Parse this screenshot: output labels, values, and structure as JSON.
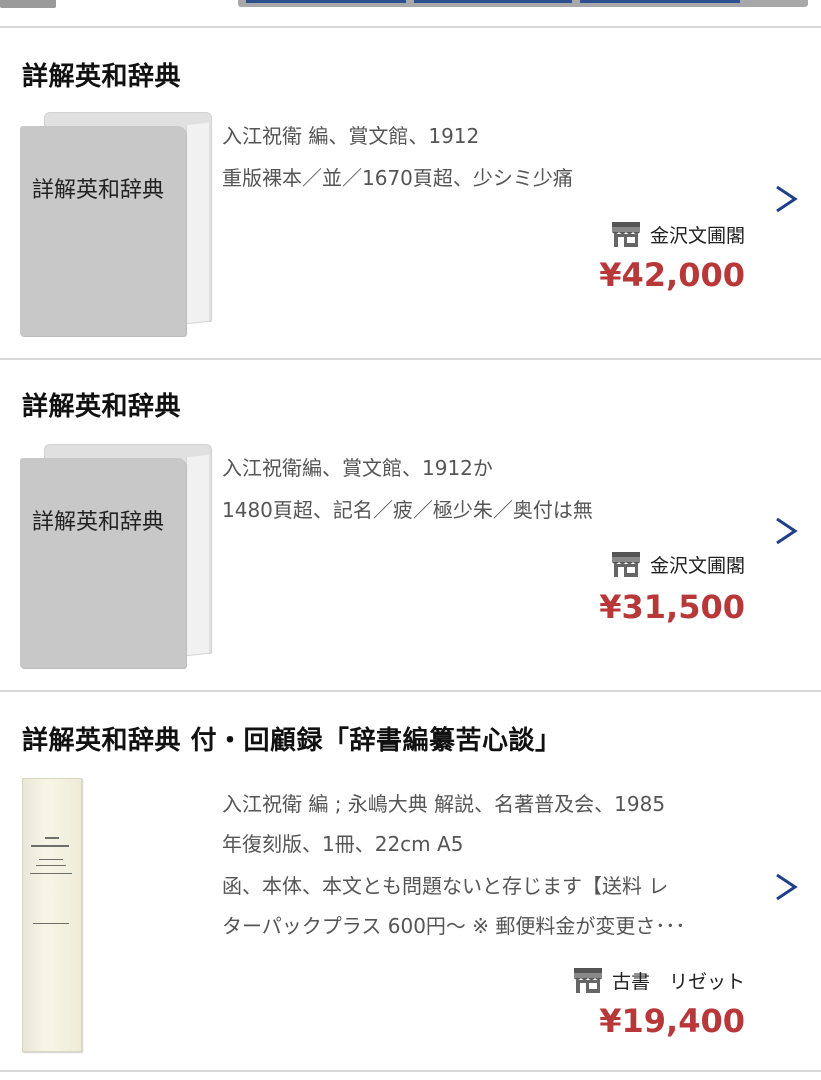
{
  "listings": [
    {
      "title": "詳解英和辞典",
      "placeholder_label": "詳解英和辞典",
      "meta": [
        "入江祝衛 編、賞文館、1912",
        "重版裸本／並／1670頁超、少シミ少痛"
      ],
      "shop": "金沢文圃閣",
      "price": "¥42,000"
    },
    {
      "title": "詳解英和辞典",
      "placeholder_label": "詳解英和辞典",
      "meta": [
        "入江祝衛編、賞文館、1912か",
        "1480頁超、記名／疲／極少朱／奥付は無"
      ],
      "shop": "金沢文圃閣",
      "price": "¥31,500"
    },
    {
      "title": "詳解英和辞典 付・回顧録「辞書編纂苦心談」",
      "meta": [
        "入江祝衛 編 ; 永嶋大典 解説、名著普及会、1985",
        "年復刻版、1冊、22cm A5",
        "函、本体、本文とも問題ないと存じます【送料 レ",
        "ターパックプラス 600円〜 ※ 郵便料金が変更さ･･･"
      ],
      "shop": "古書　リゼット",
      "price": "¥19,400"
    }
  ],
  "icons": {
    "shop": "shop-icon",
    "chevron": "chevron-right-icon"
  },
  "colors": {
    "price": "#b8383a",
    "chevron": "#1f3f8a",
    "placeholder": "#c8c8c8"
  }
}
